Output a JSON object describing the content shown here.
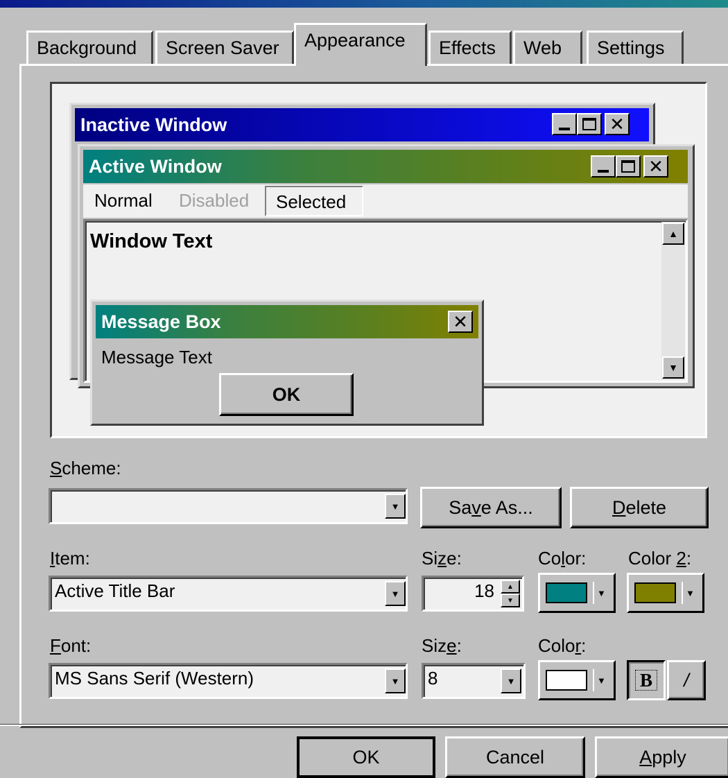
{
  "tabs": [
    {
      "label": "Background"
    },
    {
      "label": "Screen Saver"
    },
    {
      "label": "Appearance"
    },
    {
      "label": "Effects"
    },
    {
      "label": "Web"
    },
    {
      "label": "Settings"
    }
  ],
  "preview": {
    "inactive_title": "Inactive Window",
    "active_title": "Active Window",
    "menu": {
      "normal": "Normal",
      "disabled": "Disabled",
      "selected": "Selected"
    },
    "window_text": "Window Text",
    "msgbox_title": "Message Box",
    "msgbox_text": "Message Text",
    "msgbox_ok": "OK",
    "close_glyph": "✕"
  },
  "scheme": {
    "label_prefix": "S",
    "label_rest": "cheme:",
    "value": "",
    "save_as_a": "Sa",
    "save_as_u": "v",
    "save_as_b": "e As...",
    "delete_u": "D",
    "delete_rest": "elete"
  },
  "item": {
    "label_u": "I",
    "label_rest": "tem:",
    "value": "Active Title Bar",
    "size_label_a": "Si",
    "size_label_u": "z",
    "size_label_b": "e:",
    "size_value": "18",
    "color_label_a": "Co",
    "color_label_u": "l",
    "color_label_b": "or:",
    "color2_label_a": "Color ",
    "color2_label_u": "2",
    "color2_label_b": ":",
    "color": "#008080",
    "color2": "#808000"
  },
  "font": {
    "label_u": "F",
    "label_rest": "ont:",
    "value": "MS Sans Serif (Western)",
    "size_label_a": "Siz",
    "size_label_u": "e",
    "size_label_b": ":",
    "size_value": "8",
    "color_label_a": "Colo",
    "color_label_u": "r",
    "color_label_b": ":",
    "color": "#ffffff",
    "bold_label": "B",
    "italic_label": "/"
  },
  "footer": {
    "ok": "OK",
    "cancel": "Cancel",
    "apply_u": "A",
    "apply_rest": "pply"
  },
  "colors": {
    "inactive_gradient_start": "#000080",
    "inactive_gradient_end": "#1010ff",
    "active_gradient_start": "#008080",
    "active_gradient_end": "#808000"
  }
}
